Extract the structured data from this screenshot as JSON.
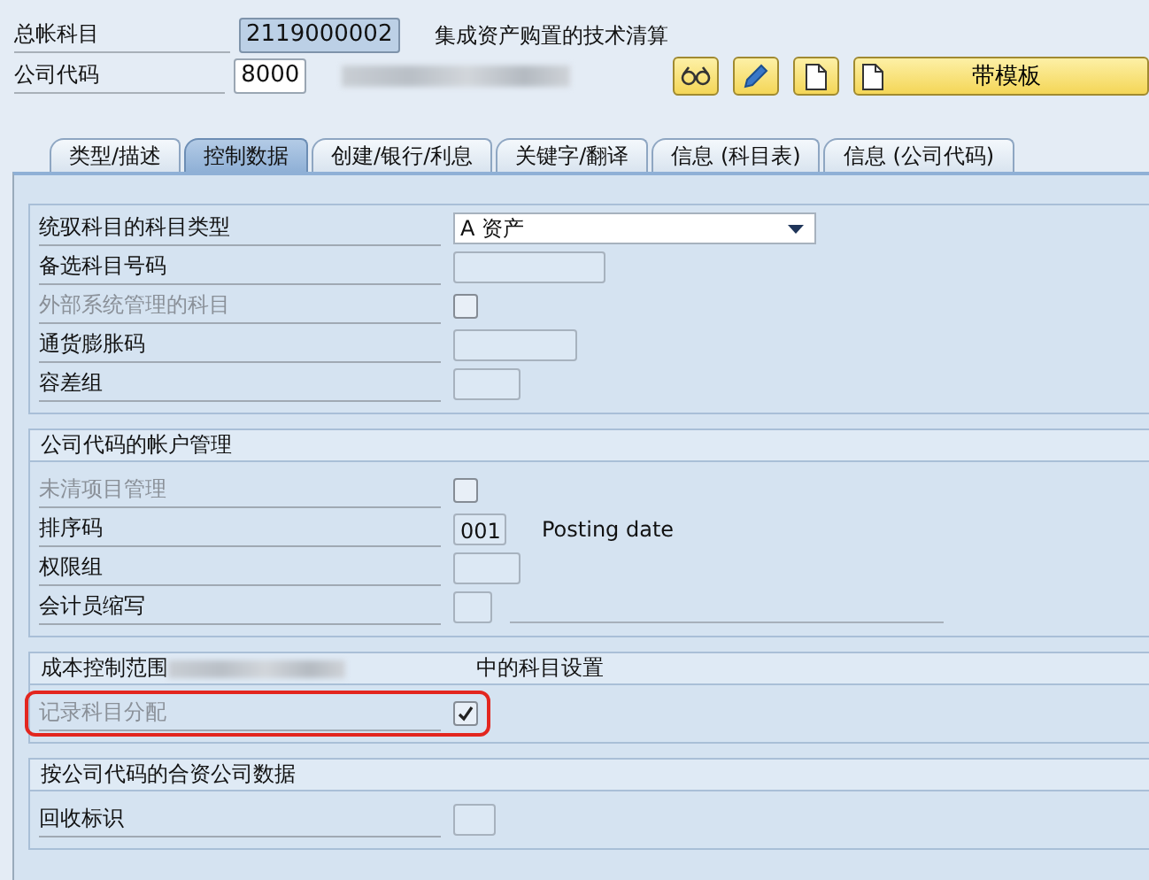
{
  "header": {
    "gl_account": {
      "label": "总帐科目",
      "value": "2119000002",
      "description": "集成资产购置的技术清算"
    },
    "company_code": {
      "label": "公司代码",
      "value": "8000",
      "redacted": true
    }
  },
  "toolbar": [
    {
      "kind": "display"
    },
    {
      "kind": "edit"
    },
    {
      "kind": "document"
    },
    {
      "kind": "template",
      "label": "带模板"
    }
  ],
  "tabs": [
    {
      "label": "类型/描述",
      "selected": false
    },
    {
      "label": "控制数据",
      "selected": true
    },
    {
      "label": "创建/银行/利息",
      "selected": false
    },
    {
      "label": "关键字/翻译",
      "selected": false
    },
    {
      "label": "信息 (科目表)",
      "selected": false
    },
    {
      "label": "信息 (公司代码)",
      "selected": false
    }
  ],
  "groups": [
    {
      "rows": [
        {
          "kind": "dropdown",
          "label": "统驭科目的科目类型",
          "value": "A 资产",
          "disabled": false
        },
        {
          "kind": "input",
          "label": "备选科目号码",
          "disabled": false
        },
        {
          "kind": "checkbox",
          "label": "外部系统管理的科目",
          "checked": false,
          "disabled": true
        },
        {
          "kind": "input",
          "label": "通货膨胀码",
          "disabled": false
        },
        {
          "kind": "input",
          "label": "容差组",
          "disabled": false
        }
      ]
    },
    {
      "title": "公司代码的帐户管理",
      "rows": [
        {
          "kind": "checkbox",
          "label": "未清项目管理",
          "checked": false,
          "disabled": true
        },
        {
          "kind": "input",
          "label": "排序码",
          "value": "001",
          "description": "Posting date",
          "disabled": false
        },
        {
          "kind": "input",
          "label": "权限组",
          "disabled": false
        },
        {
          "kind": "input",
          "label": "会计员缩写",
          "disabled": false,
          "display_line": true
        }
      ]
    },
    {
      "title": "成本控制范围",
      "title_redacted": true,
      "title_suffix": "中的科目设置",
      "rows": [
        {
          "kind": "checkbox",
          "label": "记录科目分配",
          "checked": true,
          "disabled": true,
          "highlighted": true
        }
      ]
    },
    {
      "title": "按公司代码的合资公司数据",
      "rows": [
        {
          "kind": "input",
          "label": "回收标识",
          "disabled": false
        }
      ]
    }
  ]
}
